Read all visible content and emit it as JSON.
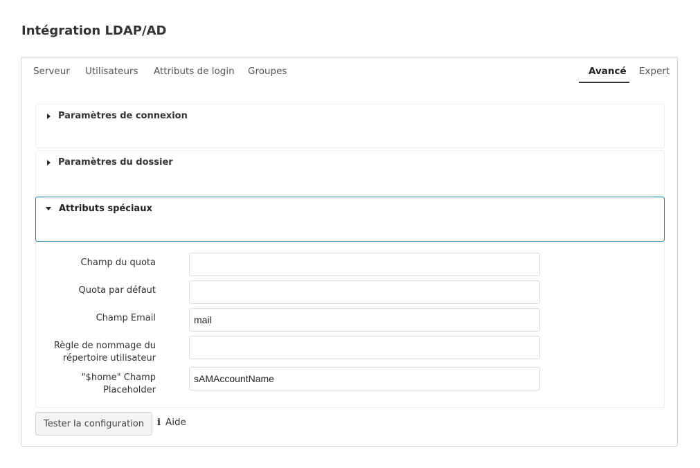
{
  "page": {
    "title": "Intégration LDAP/AD"
  },
  "tabs": [
    {
      "label": "Serveur",
      "active": false
    },
    {
      "label": "Utilisateurs",
      "active": false
    },
    {
      "label": "Attributs de login",
      "active": false
    },
    {
      "label": "Groupes",
      "active": false
    },
    {
      "label": "Avancé",
      "active": true
    },
    {
      "label": "Expert",
      "active": false
    }
  ],
  "sections": [
    {
      "title": "Paramètres de connexion",
      "expanded": false
    },
    {
      "title": "Paramètres du dossier",
      "expanded": false
    },
    {
      "title": "Attributs spéciaux",
      "expanded": true
    }
  ],
  "fields": [
    {
      "label": "Champ du quota",
      "value": ""
    },
    {
      "label": "Quota par défaut",
      "value": ""
    },
    {
      "label": "Champ Email",
      "value": "mail"
    },
    {
      "label_line1": "Règle de nommage du",
      "label_line2": "répertoire utilisateur",
      "value": ""
    },
    {
      "label_line1": "\"$home\" Champ",
      "label_line2": "Placeholder",
      "value": "sAMAccountName"
    }
  ],
  "actions": {
    "test_label": "Tester la configuration",
    "help_label": "Aide"
  },
  "icons": {
    "collapsed": "caret-right-icon",
    "expanded": "caret-down-icon",
    "help": "info-icon"
  },
  "colors": {
    "accent_border": "#0a7ab8"
  }
}
